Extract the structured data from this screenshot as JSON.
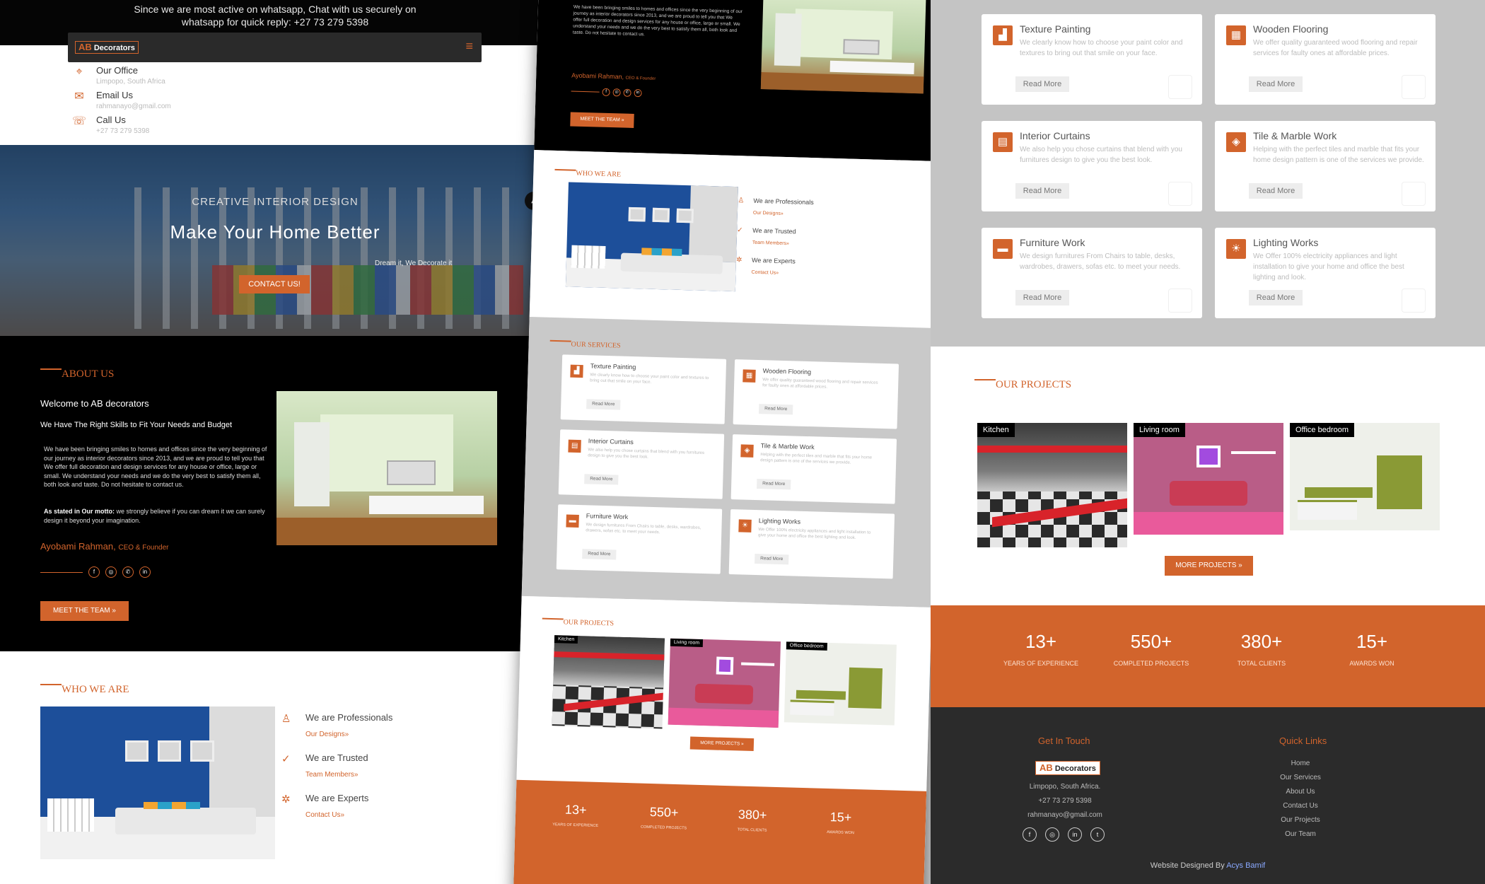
{
  "whatsapp_bar": {
    "line1": "Since we are most active on whatsapp, Chat with us securely on",
    "line2": "whatsapp for quick reply: +27 73 279 5398"
  },
  "brand": {
    "logo_ab": "AB",
    "logo_text": "Decorators",
    "menu_icon": "hamburger-icon"
  },
  "contact": [
    {
      "label": "Our Office",
      "value": "Limpopo, South Africa",
      "icon": "location-pin-icon"
    },
    {
      "label": "Email Us",
      "value": "rahmanayo@gmail.com",
      "icon": "envelope-icon"
    },
    {
      "label": "Call Us",
      "value": "+27 73 279 5398",
      "icon": "phone-icon"
    }
  ],
  "hero": {
    "subtitle": "CREATIVE INTERIOR DESIGN",
    "title": "Make Your Home Better",
    "tagline": "Dream it, We Decorate it",
    "button": "CONTACT US!"
  },
  "about": {
    "section": "ABOUT US",
    "welcome": "Welcome to AB decorators",
    "subheading": "We Have The Right Skills to Fit Your Needs and Budget",
    "paragraph": "We have been bringing smiles to homes and offices since the very beginning of our journey as interior decorators since 2013, and we are proud to tell you that We offer full decoration and design services for any house or office, large or small. We understand your needs and we do the very best to satisfy them all, both look and taste. Do not hesitate to contact us.",
    "motto_lead": "As stated in Our motto:",
    "motto": " we strongly believe if you can dream it we can surely design it beyond your imagination.",
    "signature": "Ayobami Rahman,",
    "role": "CEO & Founder",
    "social": [
      "facebook-icon",
      "instagram-icon",
      "whatsapp-icon",
      "linkedin-icon"
    ],
    "button": "MEET THE TEAM »"
  },
  "who": {
    "section": "WHO WE ARE",
    "items": [
      {
        "title": "We are Professionals",
        "link": "Our Designs»",
        "icon": "award-icon"
      },
      {
        "title": "We are Trusted",
        "link": "Team Members»",
        "icon": "check-circle-icon"
      },
      {
        "title": "We are Experts",
        "link": "Contact Us»",
        "icon": "gear-icon"
      }
    ]
  },
  "services": {
    "section": "OUR SERVICES",
    "read_more": "Read More",
    "items": [
      {
        "title": "Texture Painting",
        "desc": "We clearly know how to choose your paint color and textures to bring out that smile on your face.",
        "icon": "paint-roller-icon"
      },
      {
        "title": "Wooden Flooring",
        "desc": "We offer quality guaranteed wood flooring and repair services for faulty ones at affordable prices.",
        "icon": "floor-pattern-icon"
      },
      {
        "title": "Interior Curtains",
        "desc": "We also help you chose curtains that blend with you furnitures design to give you the best look.",
        "icon": "curtain-icon"
      },
      {
        "title": "Tile & Marble Work",
        "desc": "Helping with the perfect tiles and marble that fits your home design pattern is one of the services we provide.",
        "icon": "tile-icon"
      },
      {
        "title": "Furniture Work",
        "desc": "We design furnitures From Chairs to table, desks, wardrobes, drawers, sofas etc. to meet your needs.",
        "icon": "sofa-icon"
      },
      {
        "title": "Lighting Works",
        "desc": "We Offer 100% electricity appliances and light installation to give your home and office the best lighting and look.",
        "icon": "lightbulb-icon"
      }
    ]
  },
  "projects": {
    "section": "OUR PROJECTS",
    "items": [
      {
        "tag": "Kitchen"
      },
      {
        "tag": "Living room"
      },
      {
        "tag": "Office bedroom"
      }
    ],
    "button": "MORE PROJECTS »"
  },
  "stats": [
    {
      "value": "13+",
      "label": "YEARS OF EXPERIENCE"
    },
    {
      "value": "550+",
      "label": "COMPLETED PROJECTS"
    },
    {
      "value": "380+",
      "label": "TOTAL CLIENTS"
    },
    {
      "value": "15+",
      "label": "AWARDS WON"
    }
  ],
  "footer": {
    "touch_heading": "Get In Touch",
    "address": "Limpopo, South Africa.",
    "phone": "+27 73 279 5398",
    "email": "rahmanayo@gmail.com",
    "social": [
      "facebook-icon",
      "instagram-icon",
      "linkedin-icon",
      "twitter-icon"
    ],
    "links_heading": "Quick Links",
    "links": [
      "Home",
      "Our Services",
      "About Us",
      "Contact Us",
      "Our Projects",
      "Our Team"
    ],
    "credit_prefix": "Website Designed By ",
    "credit_name": "Acys Bamif"
  },
  "colors": {
    "accent": "#d2642c",
    "dark": "#000000",
    "footer": "#2b2b2b",
    "services_bg": "#c4c4c4"
  }
}
